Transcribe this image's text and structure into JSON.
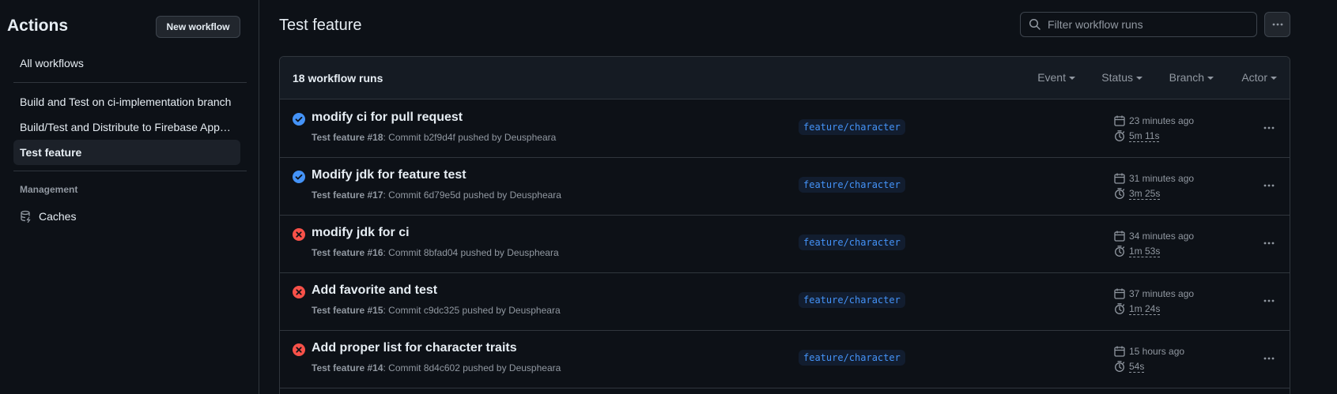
{
  "sidebar": {
    "title": "Actions",
    "new_workflow_label": "New workflow",
    "items": [
      {
        "label": "All workflows"
      },
      {
        "label": "Build and Test on ci-implementation branch"
      },
      {
        "label": "Build/Test and Distribute to Firebase App Distribution"
      },
      {
        "label": "Test feature",
        "active": true
      }
    ],
    "management_heading": "Management",
    "caches_label": "Caches"
  },
  "main": {
    "title": "Test feature",
    "filter_placeholder": "Filter workflow runs",
    "runs_count_label": "18 workflow runs",
    "filters": [
      "Event",
      "Status",
      "Branch",
      "Actor"
    ],
    "runs": [
      {
        "status": "success",
        "title": "modify ci for pull request",
        "workflow": "Test feature",
        "number": "#18",
        "commit_text": ": Commit b2f9d4f pushed by Deuspheara",
        "branch": "feature/character",
        "time_ago": "23 minutes ago",
        "duration": "5m 11s"
      },
      {
        "status": "success",
        "title": "Modify jdk for feature test",
        "workflow": "Test feature",
        "number": "#17",
        "commit_text": ": Commit 6d79e5d pushed by Deuspheara",
        "branch": "feature/character",
        "time_ago": "31 minutes ago",
        "duration": "3m 25s"
      },
      {
        "status": "failure",
        "title": "modify jdk for ci",
        "workflow": "Test feature",
        "number": "#16",
        "commit_text": ": Commit 8bfad04 pushed by Deuspheara",
        "branch": "feature/character",
        "time_ago": "34 minutes ago",
        "duration": "1m 53s"
      },
      {
        "status": "failure",
        "title": "Add favorite and test",
        "workflow": "Test feature",
        "number": "#15",
        "commit_text": ": Commit c9dc325 pushed by Deuspheara",
        "branch": "feature/character",
        "time_ago": "37 minutes ago",
        "duration": "1m 24s"
      },
      {
        "status": "failure",
        "title": "Add proper list for character traits",
        "workflow": "Test feature",
        "number": "#14",
        "commit_text": ": Commit 8d4c602 pushed by Deuspheara",
        "branch": "feature/character",
        "time_ago": "15 hours ago",
        "duration": "54s"
      }
    ]
  },
  "colors": {
    "success": "#4493f8",
    "failure": "#f85149",
    "accent": "#4493f8",
    "background": "#0d1117"
  }
}
